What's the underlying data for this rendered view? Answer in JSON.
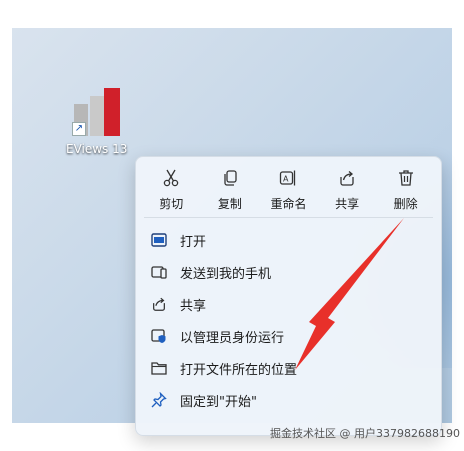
{
  "desktop": {
    "icon_label": "EViews 13"
  },
  "context_menu": {
    "toolbar": [
      {
        "label": "剪切",
        "icon": "cut-icon"
      },
      {
        "label": "复制",
        "icon": "copy-icon"
      },
      {
        "label": "重命名",
        "icon": "rename-icon"
      },
      {
        "label": "共享",
        "icon": "share-icon"
      },
      {
        "label": "删除",
        "icon": "delete-icon"
      }
    ],
    "items": [
      {
        "label": "打开",
        "icon": "open-icon"
      },
      {
        "label": "发送到我的手机",
        "icon": "phone-icon"
      },
      {
        "label": "共享",
        "icon": "share-icon"
      },
      {
        "label": "以管理员身份运行",
        "icon": "shield-icon"
      },
      {
        "label": "打开文件所在的位置",
        "icon": "folder-icon"
      },
      {
        "label": "固定到\"开始\"",
        "icon": "pin-icon"
      }
    ]
  },
  "watermark": "掘金技术社区 @ 用户337982688190",
  "colors": {
    "arrow": "#e8302a",
    "menu_bg": "#eef4fa",
    "eviews_red": "#d0202a"
  }
}
